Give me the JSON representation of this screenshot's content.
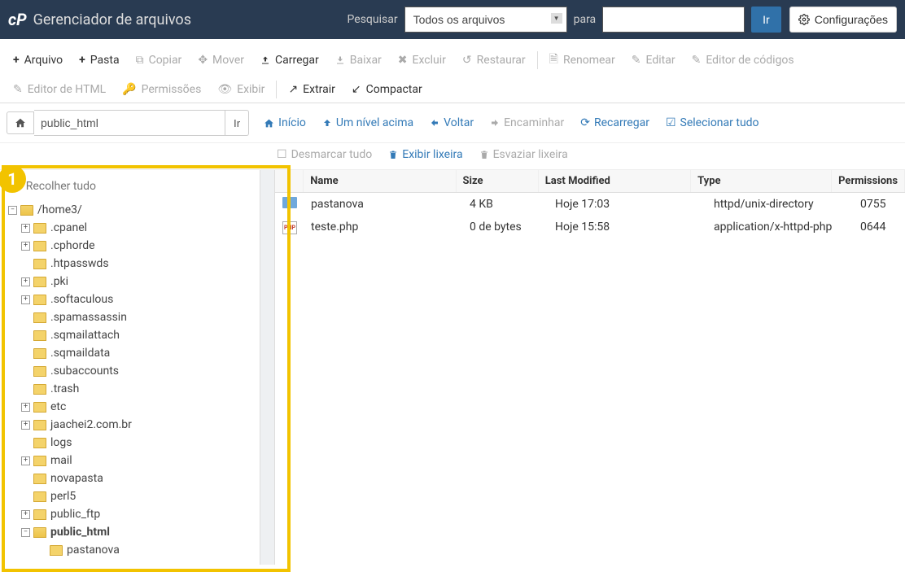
{
  "header": {
    "title": "Gerenciador de arquivos",
    "search_label": "Pesquisar",
    "search_scope": "Todos os arquivos",
    "for_label": "para",
    "go_label": "Ir",
    "settings_label": "Configurações"
  },
  "toolbar": {
    "arquivo": "Arquivo",
    "pasta": "Pasta",
    "copiar": "Copiar",
    "mover": "Mover",
    "carregar": "Carregar",
    "baixar": "Baixar",
    "excluir": "Excluir",
    "restaurar": "Restaurar",
    "renomear": "Renomear",
    "editar": "Editar",
    "editor_codigos": "Editor de códigos",
    "editor_html": "Editor de HTML",
    "permissoes": "Permissões",
    "exibir": "Exibir",
    "extrair": "Extrair",
    "compactar": "Compactar"
  },
  "location": {
    "path": "public_html",
    "go": "Ir"
  },
  "nav": {
    "inicio": "Início",
    "um_nivel": "Um nível acima",
    "voltar": "Voltar",
    "encaminhar": "Encaminhar",
    "recarregar": "Recarregar",
    "selecionar_tudo": "Selecionar tudo",
    "desmarcar_tudo": "Desmarcar tudo",
    "exibir_lixeira": "Exibir lixeira",
    "esvaziar_lixeira": "Esvaziar lixeira"
  },
  "sidebar": {
    "collapse_all": "Recolher tudo",
    "root": "/home3/",
    "items": [
      {
        "label": ".cpanel",
        "expandable": true
      },
      {
        "label": ".cphorde",
        "expandable": true
      },
      {
        "label": ".htpasswds",
        "expandable": false
      },
      {
        "label": ".pki",
        "expandable": true
      },
      {
        "label": ".softaculous",
        "expandable": true
      },
      {
        "label": ".spamassassin",
        "expandable": false
      },
      {
        "label": ".sqmailattach",
        "expandable": false
      },
      {
        "label": ".sqmaildata",
        "expandable": false
      },
      {
        "label": ".subaccounts",
        "expandable": false
      },
      {
        "label": ".trash",
        "expandable": false
      },
      {
        "label": "etc",
        "expandable": true
      },
      {
        "label": "jaachei2.com.br",
        "expandable": true
      },
      {
        "label": "logs",
        "expandable": false
      },
      {
        "label": "mail",
        "expandable": true
      },
      {
        "label": "novapasta",
        "expandable": false
      },
      {
        "label": "perl5",
        "expandable": false
      },
      {
        "label": "public_ftp",
        "expandable": true
      },
      {
        "label": "public_html",
        "expandable": true,
        "bold": true,
        "open": true
      },
      {
        "label": "pastanova",
        "expandable": false,
        "child": true
      }
    ]
  },
  "table": {
    "headers": {
      "name": "Name",
      "size": "Size",
      "modified": "Last Modified",
      "type": "Type",
      "perm": "Permissions"
    },
    "rows": [
      {
        "icon": "folder",
        "name": "pastanova",
        "size": "4 KB",
        "modified": "Hoje 17:03",
        "type": "httpd/unix-directory",
        "perm": "0755"
      },
      {
        "icon": "php",
        "name": "teste.php",
        "size": "0 de bytes",
        "modified": "Hoje 15:58",
        "type": "application/x-httpd-php",
        "perm": "0644"
      }
    ]
  },
  "annotation": {
    "number": "1"
  }
}
